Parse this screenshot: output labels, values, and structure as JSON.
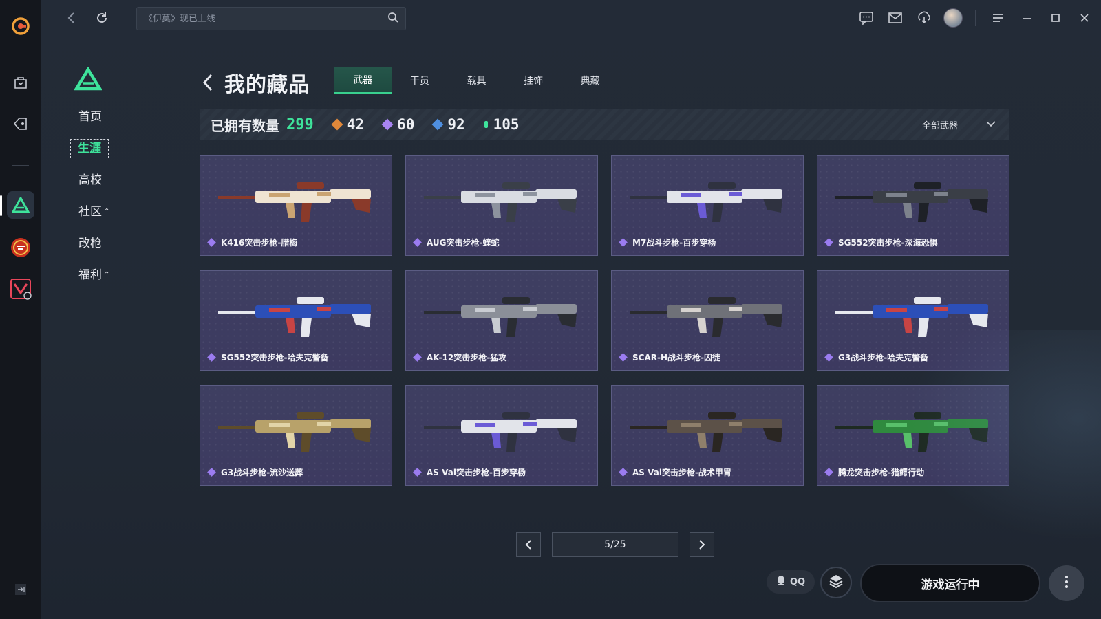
{
  "app": {
    "search_placeholder": "《伊莫》现已上线"
  },
  "rail": {
    "icons": [
      "app-logo-icon",
      "store-bag-icon",
      "tag-icon",
      "valorant-app-icon",
      "cf-app-icon",
      "game-app-icon",
      "expand-icon"
    ]
  },
  "sidebar": {
    "items": [
      {
        "label": "首页"
      },
      {
        "label": "生涯"
      },
      {
        "label": "高校"
      },
      {
        "label": "社区",
        "caret": "⌃"
      },
      {
        "label": "改枪"
      },
      {
        "label": "福利",
        "caret": "⌃"
      }
    ]
  },
  "header": {
    "title": "我的藏品",
    "tabs": [
      {
        "label": "武器"
      },
      {
        "label": "干员"
      },
      {
        "label": "载具"
      },
      {
        "label": "挂饰"
      },
      {
        "label": "典藏"
      }
    ]
  },
  "stats": {
    "owned_label": "已拥有数量",
    "owned_value": "299",
    "tiers": [
      {
        "value": "42",
        "color": "#e0883a"
      },
      {
        "value": "60",
        "color": "#a884f2"
      },
      {
        "value": "92",
        "color": "#4f8fe0"
      },
      {
        "value": "105",
        "color": "#3ee39b"
      }
    ],
    "filter_label": "全部武器"
  },
  "items": [
    {
      "name": "K416突击步枪-腊梅",
      "palette": [
        "#efe4d2",
        "#8a3a2a",
        "#caa472"
      ]
    },
    {
      "name": "AUG突击步枪-蝰蛇",
      "palette": [
        "#d9dce2",
        "#3a3f48",
        "#8d939e"
      ]
    },
    {
      "name": "M7战斗步枪-百步穿杨",
      "palette": [
        "#e2e4ea",
        "#2f3240",
        "#6b5bd6"
      ]
    },
    {
      "name": "SG552突击步枪-深海恐惧",
      "palette": [
        "#3a3e46",
        "#1e2127",
        "#7d828c"
      ]
    },
    {
      "name": "SG552突击步枪-哈夫克警备",
      "palette": [
        "#2c4fb8",
        "#e6e8ee",
        "#c84444"
      ]
    },
    {
      "name": "AK-12突击步枪-猛攻",
      "palette": [
        "#8b8f98",
        "#2a2d33",
        "#c9ccd2"
      ]
    },
    {
      "name": "SCAR-H战斗步枪-囚徒",
      "palette": [
        "#6f7178",
        "#2a2b2f",
        "#d6d2cf"
      ]
    },
    {
      "name": "G3战斗步枪-哈夫克警备",
      "palette": [
        "#2c4fb8",
        "#e6e8ee",
        "#c84444"
      ]
    },
    {
      "name": "G3战斗步枪-流沙送葬",
      "palette": [
        "#b8a26a",
        "#5e4c2a",
        "#e2d4a8"
      ]
    },
    {
      "name": "AS Val突击步枪-百步穿杨",
      "palette": [
        "#e2e4ea",
        "#2f3240",
        "#6b5bd6"
      ]
    },
    {
      "name": "AS Val突击步枪-战术甲胄",
      "palette": [
        "#5c5148",
        "#2a2622",
        "#8f7f6b"
      ]
    },
    {
      "name": "腾龙突击步枪-猎鳄行动",
      "palette": [
        "#2f8a3e",
        "#1e2a22",
        "#58c06a"
      ]
    }
  ],
  "pager": {
    "label": "5/25"
  },
  "footer": {
    "qq_label": "QQ",
    "launch_label": "游戏运行中"
  }
}
